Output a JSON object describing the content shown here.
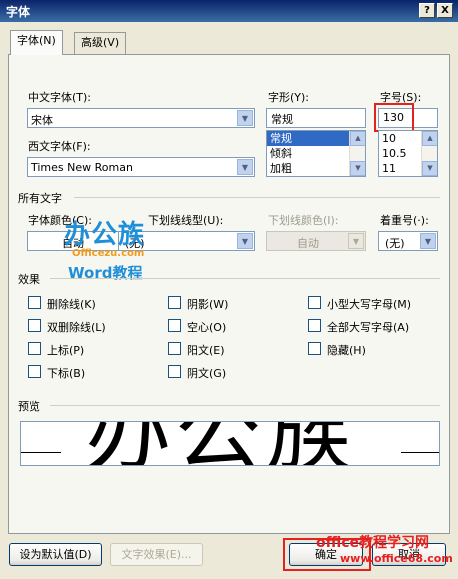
{
  "window": {
    "title": "字体",
    "help_glyph": "?",
    "close_glyph": "X"
  },
  "tabs": [
    {
      "label": "字体(N)",
      "active": true
    },
    {
      "label": "高级(V)",
      "active": false
    }
  ],
  "fonts": {
    "chinese_font_label": "中文字体(T):",
    "chinese_font_value": "宋体",
    "western_font_label": "西文字体(F):",
    "western_font_value": "Times New Roman",
    "style_label": "字形(Y):",
    "style_value": "常规",
    "style_options": [
      "常规",
      "倾斜",
      "加粗"
    ],
    "size_label": "字号(S):",
    "size_value": "130",
    "size_options": [
      "10",
      "10.5",
      "11"
    ]
  },
  "all_text": {
    "section_title": "所有文字",
    "font_color_label": "字体颜色(C):",
    "font_color_value": "自动",
    "underline_type_label": "下划线线型(U):",
    "underline_type_value": "(无)",
    "underline_color_label": "下划线颜色(I):",
    "underline_color_value": "自动",
    "emphasis_label": "着重号(·):",
    "emphasis_value": "(无)"
  },
  "effects": {
    "section_title": "效果",
    "items": [
      {
        "label": "删除线(K)"
      },
      {
        "label": "阴影(W)"
      },
      {
        "label": "小型大写字母(M)"
      },
      {
        "label": "双删除线(L)"
      },
      {
        "label": "空心(O)"
      },
      {
        "label": "全部大写字母(A)"
      },
      {
        "label": "上标(P)"
      },
      {
        "label": "阳文(E)"
      },
      {
        "label": "隐藏(H)"
      },
      {
        "label": "下标(B)"
      },
      {
        "label": "阴文(G)"
      }
    ]
  },
  "preview": {
    "section_title": "预览",
    "sample_text": "办公族"
  },
  "buttons": {
    "set_default": "设为默认值(D)",
    "text_effects": "文字效果(E)...",
    "ok": "确定",
    "cancel": "取消"
  },
  "watermarks": {
    "center_logo": "办公族",
    "center_url": "Officezu.com",
    "center_sub": "Word教程",
    "corner_title": "office教程学习网",
    "corner_url": "www.office68.com"
  },
  "colors": {
    "titlebar": "#0a246a",
    "highlight": "#316ac5",
    "red_annotation": "#e52020",
    "logo_blue": "#1f8fd8",
    "logo_orange": "#f39a1c"
  }
}
